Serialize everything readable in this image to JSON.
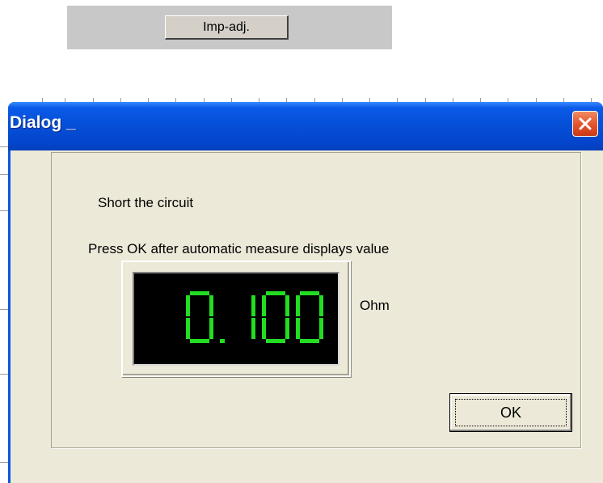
{
  "toolbar": {
    "imp_adj_label": "Imp-adj."
  },
  "dialog": {
    "title": "Dialog _",
    "line1": "Short the circuit",
    "line2": "Press OK after automatic measure displays value",
    "display": {
      "value": "0.100",
      "color": "#22dd22"
    },
    "unit": "Ohm",
    "ok_label": "OK"
  },
  "colors": {
    "titlebar": "#0a57e0",
    "client": "#ece9d8",
    "close": "#e2532c",
    "lcd_background": "#000000",
    "lcd_digits": "#22dd22"
  },
  "icons": {
    "close": "close-x-icon"
  }
}
